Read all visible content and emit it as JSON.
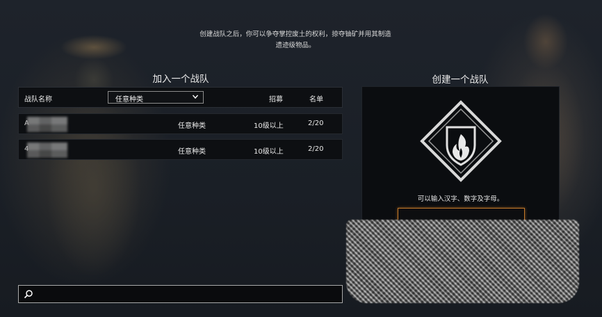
{
  "intro_text_line1": "创建战队之后，你可以争夺掌控废土的权利，掠夺铀矿并用其制造",
  "intro_text_line2": "遗迹级物品。",
  "join": {
    "title": "加入一个战队",
    "header": {
      "team_name_label": "战队名称",
      "filter_selected": "任意种类",
      "recruit_label": "招募",
      "roster_label": "名单"
    },
    "rows": [
      {
        "name": "A",
        "type": "任意种类",
        "level": "10级以上",
        "count": "2/20"
      },
      {
        "name": "4",
        "type": "任意种类",
        "level": "10级以上",
        "count": "2/20"
      }
    ]
  },
  "create": {
    "title": "创建一个战队",
    "hint": "可以输入汉字、数字及字母。"
  },
  "colors": {
    "accent_input_border": "#c47a2a",
    "panel_bg": "#0b0d10",
    "page_bg": "#1b2028"
  },
  "icons": {
    "search": "search-icon",
    "dropdown": "chevron-down-icon",
    "emblem": "squad-emblem-icon"
  }
}
